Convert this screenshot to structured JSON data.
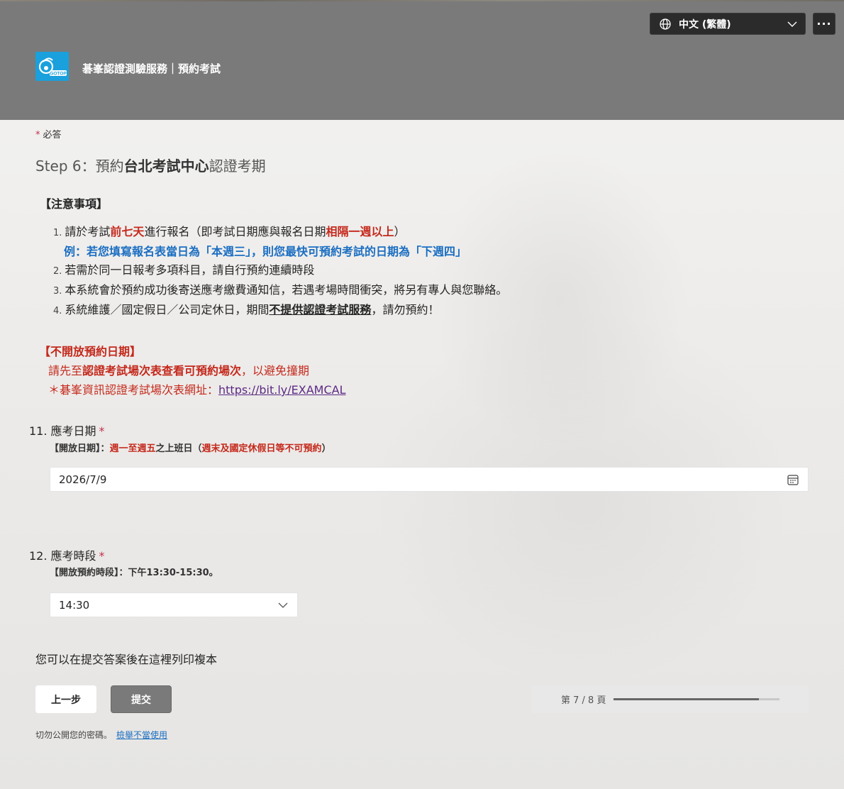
{
  "header": {
    "language": "中文 (繁體)",
    "more_label": "···",
    "logo_text": "GOTOP",
    "form_title": "碁峯認證測驗服務｜預約考試"
  },
  "required_note": "必答",
  "step_title": {
    "prefix": "Step 6：預約",
    "bold": "台北考試中心",
    "suffix": "認證考期"
  },
  "notice": {
    "heading": "【注意事項】",
    "items": [
      {
        "num": "1.",
        "t1": "請於考試",
        "r1": "前七天",
        "t2": "進行報名（即考試日期應與報名日期",
        "r2": "相隔一週以上",
        "t3": "）"
      },
      {
        "example": "例：若您填寫報名表當日為「本週三」，則您最快可預約考試的日期為「下週四」"
      },
      {
        "num": "2.",
        "text": "若需於同一日報考多項科目，請自行預約連續時段"
      },
      {
        "num": "3.",
        "text": "本系統會於預約成功後寄送應考繳費通知信，若遇考場時間衝突，將另有專人與您聯絡。"
      },
      {
        "num": "4.",
        "t1": "系統維護／國定假日／公司定休日，期間",
        "u": "不提供認證考試服務",
        "t2": "，請勿預約！"
      }
    ]
  },
  "closed_dates": {
    "heading": "【不開放預約日期】",
    "line1_pre": "請先至",
    "line1_bold": "認證考試場次表查看可預約場次",
    "line1_post": "，以避免撞期",
    "line2_pre": "＊碁峯資訊認證考試場次表網址：",
    "link": "https://bit.ly/EXAMCAL"
  },
  "q11": {
    "label": "11. 應考日期",
    "star": "*",
    "sub_head": "【開放日期】：",
    "sub_r1": "週一至週五",
    "sub_mid": "之上班日（",
    "sub_r2": "週末及國定休假日等不可預約",
    "sub_end": "）",
    "value": "2026/7/9"
  },
  "q12": {
    "label": "12. 應考時段",
    "star": "*",
    "sub": "【開放預約時段】：下午13:30-15:30。",
    "value": "14:30"
  },
  "print_note": "您可以在提交答案後在這裡列印複本",
  "buttons": {
    "prev": "上一步",
    "submit": "提交"
  },
  "progress": {
    "label": "第 7 / 8 頁",
    "fraction": 0.875
  },
  "footer": {
    "warning": "切勿公開您的密碼。",
    "report_link": "檢舉不當使用"
  }
}
